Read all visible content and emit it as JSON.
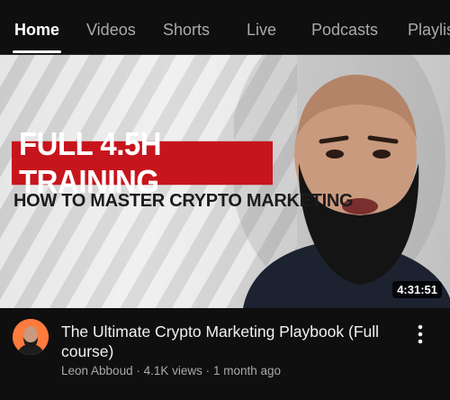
{
  "tabs": [
    {
      "label": "Home",
      "active": true
    },
    {
      "label": "Videos",
      "active": false
    },
    {
      "label": "Shorts",
      "active": false
    },
    {
      "label": "Live",
      "active": false
    },
    {
      "label": "Podcasts",
      "active": false
    },
    {
      "label": "Playlis",
      "active": false
    }
  ],
  "video": {
    "thumbnail_headline": "FULL 4.5H TRAINING",
    "thumbnail_subhead": "HOW TO MASTER CRYPTO MARKETING",
    "duration": "4:31:51",
    "title": "The Ultimate Crypto Marketing Playbook (Full course)",
    "channel": "Leon Abboud",
    "views": "4.1K views",
    "age": "1 month ago",
    "separator": "·"
  },
  "icons": {
    "more": "more-vertical-icon",
    "avatar": "channel-avatar"
  },
  "colors": {
    "background": "#0f0f0f",
    "banner_red": "#c7151d",
    "secondary_text": "#aaaaaa",
    "avatar_orange": "#ff7a3d"
  }
}
